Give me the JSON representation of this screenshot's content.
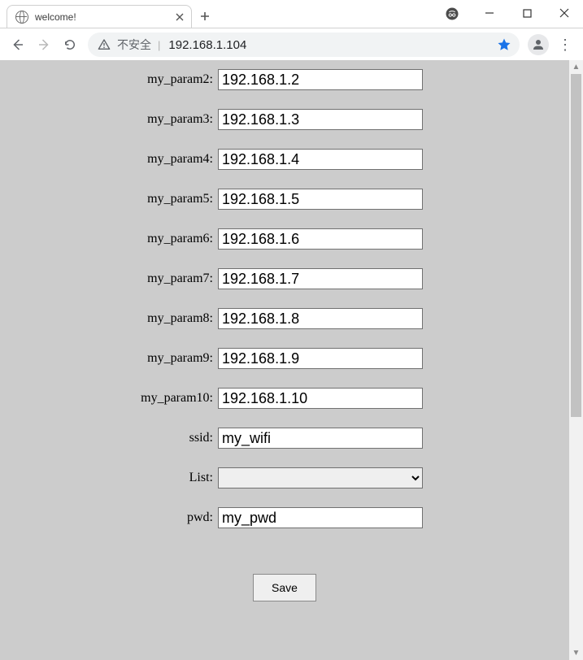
{
  "window": {
    "tab_title": "welcome!",
    "security_label": "不安全",
    "url": "192.168.1.104"
  },
  "form": {
    "rows": [
      {
        "label": "",
        "value": ""
      },
      {
        "label": "my_param2:",
        "value": "192.168.1.2"
      },
      {
        "label": "my_param3:",
        "value": "192.168.1.3"
      },
      {
        "label": "my_param4:",
        "value": "192.168.1.4"
      },
      {
        "label": "my_param5:",
        "value": "192.168.1.5"
      },
      {
        "label": "my_param6:",
        "value": "192.168.1.6"
      },
      {
        "label": "my_param7:",
        "value": "192.168.1.7"
      },
      {
        "label": "my_param8:",
        "value": "192.168.1.8"
      },
      {
        "label": "my_param9:",
        "value": "192.168.1.9"
      },
      {
        "label": "my_param10:",
        "value": "192.168.1.10"
      },
      {
        "label": "ssid:",
        "value": "my_wifi"
      }
    ],
    "list_label": "List:",
    "list_value": "",
    "pwd_label": "pwd:",
    "pwd_value": "my_pwd",
    "save_label": "Save"
  }
}
